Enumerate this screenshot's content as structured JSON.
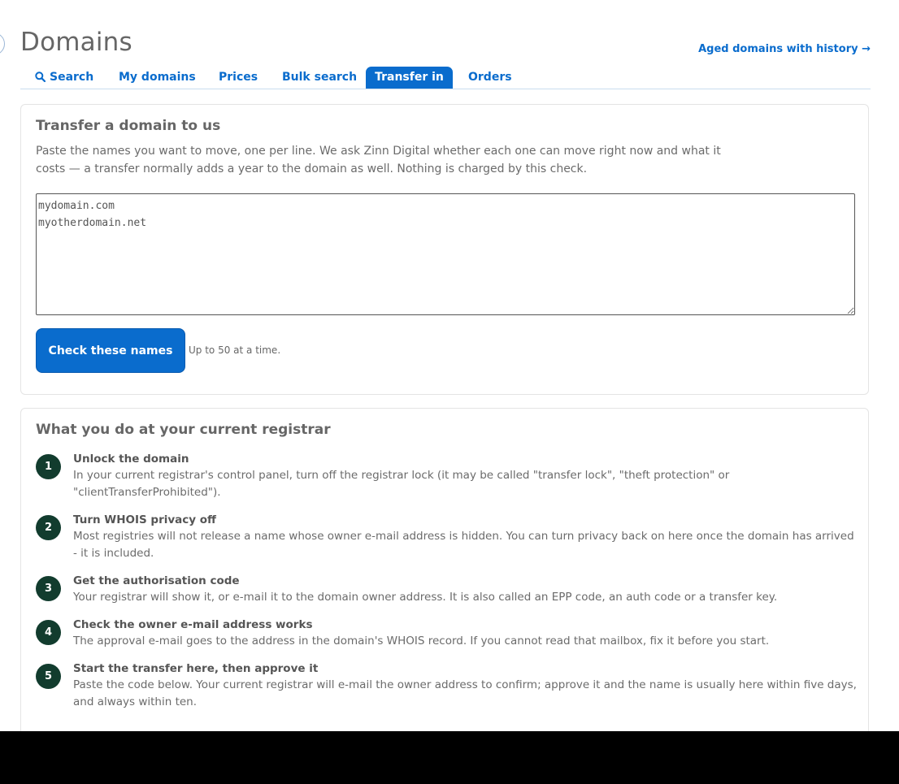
{
  "header": {
    "title": "Domains",
    "aged_link": "Aged domains with history →"
  },
  "tabs": [
    {
      "label": "Search",
      "icon": "search-icon",
      "active": false
    },
    {
      "label": "My domains",
      "active": false
    },
    {
      "label": "Prices",
      "active": false
    },
    {
      "label": "Bulk search",
      "active": false
    },
    {
      "label": "Transfer in",
      "active": true
    },
    {
      "label": "Orders",
      "active": false
    }
  ],
  "transfer": {
    "title": "Transfer a domain to us",
    "intro": "Paste the names you want to move, one per line. We ask Zinn Digital whether each one can move right now and what it costs — a transfer normally adds a year to the domain as well. Nothing is charged by this check.",
    "input_value": "mydomain.com\nmyotherdomain.net",
    "button_label": "Check these names",
    "button_note": "Up to 50 at a time."
  },
  "registrar": {
    "title": "What you do at your current registrar",
    "steps": [
      {
        "number": "1",
        "title": "Unlock the domain",
        "text": "In your current registrar's control panel, turn off the registrar lock (it may be called \"transfer lock\", \"theft protection\" or \"clientTransferProhibited\")."
      },
      {
        "number": "2",
        "title": "Turn WHOIS privacy off",
        "text": "Most registries will not release a name whose owner e-mail address is hidden. You can turn privacy back on here once the domain has arrived - it is included."
      },
      {
        "number": "3",
        "title": "Get the authorisation code",
        "text": "Your registrar will show it, or e-mail it to the domain owner address. It is also called an EPP code, an auth code or a transfer key."
      },
      {
        "number": "4",
        "title": "Check the owner e-mail address works",
        "text": "The approval e-mail goes to the address in the domain's WHOIS record. If you cannot read that mailbox, fix it before you start."
      },
      {
        "number": "5",
        "title": "Start the transfer here, then approve it",
        "text": "Paste the code below. Your current registrar will e-mail the owner address to confirm; approve it and the name is usually here within five days, and always within ten."
      }
    ]
  },
  "colors": {
    "accent": "#0a6ccd",
    "step_badge": "#123c2e",
    "title_grey": "#666666"
  }
}
